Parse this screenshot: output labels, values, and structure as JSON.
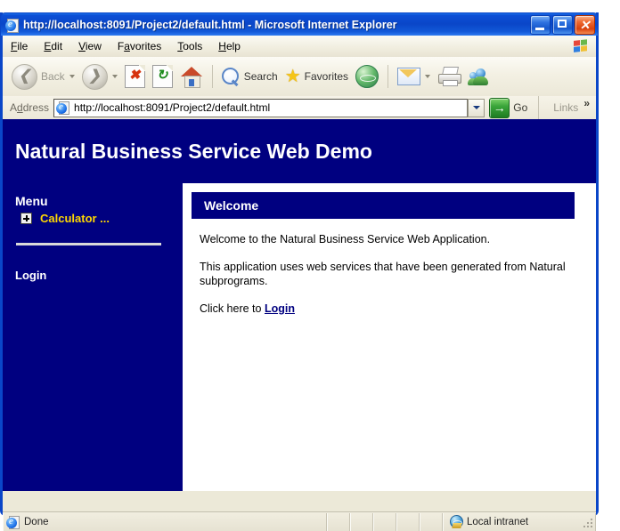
{
  "window": {
    "title": "http://localhost:8091/Project2/default.html - Microsoft Internet Explorer",
    "title_icon": "ie-page-icon",
    "minimize_label": "Minimize",
    "maximize_label": "Maximize",
    "close_label": "Close"
  },
  "menubar": {
    "items": [
      {
        "pre": "",
        "accel": "F",
        "post": "ile",
        "name": "menu-file"
      },
      {
        "pre": "",
        "accel": "E",
        "post": "dit",
        "name": "menu-edit"
      },
      {
        "pre": "",
        "accel": "V",
        "post": "iew",
        "name": "menu-view"
      },
      {
        "pre": "F",
        "accel": "a",
        "post": "vorites",
        "name": "menu-favorites"
      },
      {
        "pre": "",
        "accel": "T",
        "post": "ools",
        "name": "menu-tools"
      },
      {
        "pre": "",
        "accel": "H",
        "post": "elp",
        "name": "menu-help"
      }
    ],
    "brand_icon": "windows-flag-icon"
  },
  "toolbar": {
    "back_label": "Back",
    "forward_label": "",
    "stop_label": "Stop",
    "refresh_label": "Refresh",
    "home_label": "Home",
    "search_label": "Search",
    "favorites_label": "Favorites",
    "media_label": "Media",
    "mail_label": "Mail",
    "print_label": "Print",
    "messenger_label": "Messenger"
  },
  "address": {
    "label_pre": "A",
    "label_accel": "d",
    "label_post": "dress",
    "url": "http://localhost:8091/Project2/default.html",
    "placeholder": "",
    "go_label": "Go",
    "links_label": "Links",
    "chevron": "»"
  },
  "page": {
    "title": "Natural Business Service Web Demo",
    "header_bg": "#000080",
    "sidebar": {
      "heading": "Menu",
      "items": [
        {
          "label": "Calculator ...",
          "expander": "plus-box-icon",
          "color": "#ffd700"
        }
      ],
      "login_label": "Login"
    },
    "panel": {
      "heading": "Welcome",
      "paragraphs": [
        "Welcome to the Natural Business Service Web Application.",
        "This application uses web services that have been generated from Natural subprograms."
      ],
      "cta_prefix": "Click here to ",
      "cta_link": "Login"
    }
  },
  "statusbar": {
    "status_text": "Done",
    "status_icon": "ie-page-icon",
    "zone_text": "Local intranet",
    "zone_icon": "globe-zone-icon"
  }
}
